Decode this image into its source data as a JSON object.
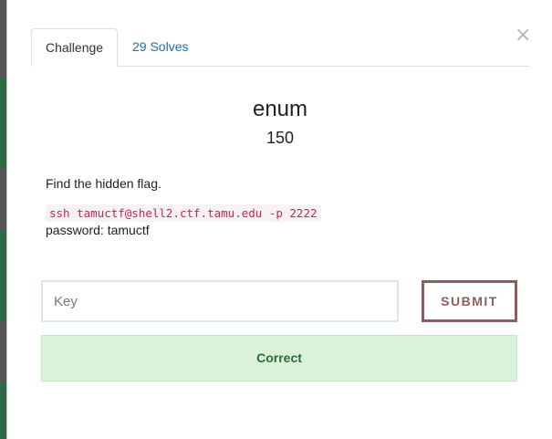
{
  "modal": {
    "close_symbol": "×",
    "tabs": [
      {
        "label": "Challenge",
        "active": true
      },
      {
        "label": "29 Solves",
        "active": false
      }
    ],
    "challenge": {
      "name": "enum",
      "points": "150",
      "description": "Find the hidden flag.",
      "command": "ssh tamuctf@shell2.ctf.tamu.edu -p 2222",
      "password_line": "password: tamuctf"
    },
    "key_input": {
      "placeholder": "Key",
      "value": ""
    },
    "submit_label": "SUBMIT",
    "result_message": "Correct"
  },
  "colors": {
    "link": "#1e6ea8",
    "submit_border": "#8e5d5d",
    "success_bg": "#d9f2d9",
    "success_text": "#2d6a3a",
    "code_text": "#c7254e",
    "code_bg": "#f9f2f4"
  },
  "icons": {
    "close": "close-icon"
  }
}
